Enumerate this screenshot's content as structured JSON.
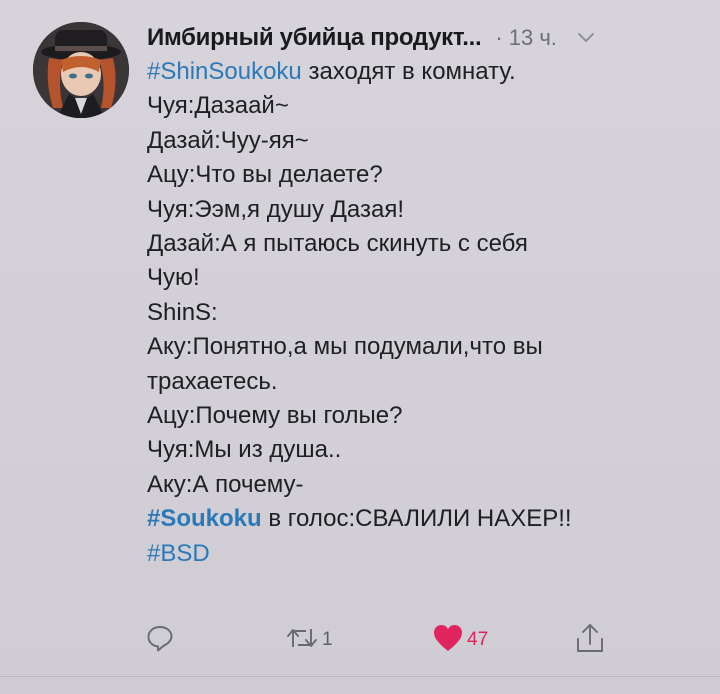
{
  "tweet": {
    "author": "Имбирный убийца продукт...",
    "time": "· 13 ч.",
    "lines": [
      {
        "tag": "#ShinSoukoku",
        "text": " заходят в комнату."
      },
      {
        "text": "Чуя:Дазаай~"
      },
      {
        "text": "Дазай:Чуу-яя~"
      },
      {
        "text": "Ацу:Что вы делаете?"
      },
      {
        "text": "Чуя:Ээм,я душу Дазая!"
      },
      {
        "text": "Дазай:А я пытаюсь скинуть с себя"
      },
      {
        "text": "Чую!"
      },
      {
        "text": "ShinS:"
      },
      {
        "text": "Аку:Понятно,а мы подумали,что вы"
      },
      {
        "text": "трахаетесь."
      },
      {
        "text": "Ацу:Почему вы голые?"
      },
      {
        "text": "Чуя:Мы из душа.."
      },
      {
        "text": "Аку:А почему-"
      },
      {
        "tag": "#Soukoku",
        "text": " в голос:СВАЛИЛИ НАХЕР!!"
      },
      {
        "tag": "#BSD",
        "text": ""
      }
    ],
    "actions": {
      "reply": {
        "icon": "reply-icon",
        "count": ""
      },
      "retweet": {
        "icon": "retweet-icon",
        "count": "1"
      },
      "like": {
        "icon": "heart-icon",
        "count": "47",
        "liked": true
      },
      "share": {
        "icon": "share-icon",
        "count": ""
      }
    }
  },
  "colors": {
    "background": "#d2d0d6",
    "text": "#202024",
    "hashtag": "#2a79b8",
    "muted": "#6f6d75",
    "like": "#e0245e"
  }
}
